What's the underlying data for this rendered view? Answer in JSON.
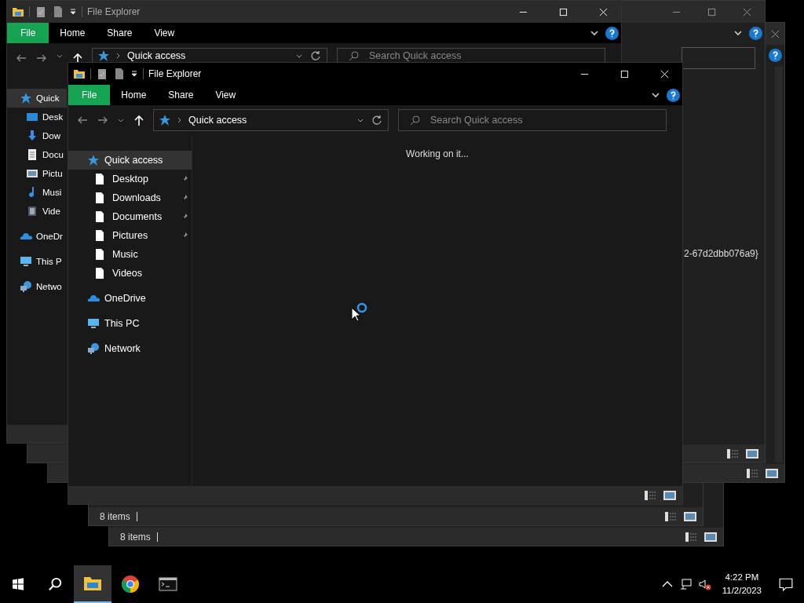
{
  "background_windows": [
    {
      "kind": "status",
      "status_text": "8 items"
    },
    {
      "kind": "status",
      "status_text": "8 items"
    },
    {
      "kind": "edge"
    },
    {
      "kind": "path",
      "path_text": "2-67d2dbb076a9}"
    }
  ],
  "back_window": {
    "title": "File Explorer",
    "tabs": [
      {
        "label": "File",
        "kind": "file"
      },
      {
        "label": "Home",
        "kind": "tab"
      },
      {
        "label": "Share",
        "kind": "tab"
      },
      {
        "label": "View",
        "kind": "tab"
      }
    ],
    "address": "Quick access",
    "search_placeholder": "Search Quick access",
    "nav_items": [
      {
        "label": "Quick",
        "kind": "quick",
        "selected": true,
        "children": [
          {
            "label": "Desk",
            "kind": "desktop"
          },
          {
            "label": "Dow",
            "kind": "downloads"
          },
          {
            "label": "Docu",
            "kind": "documents"
          },
          {
            "label": "Pictu",
            "kind": "pictures"
          },
          {
            "label": "Musi",
            "kind": "music"
          },
          {
            "label": "Vide",
            "kind": "videos"
          }
        ]
      },
      {
        "label": "OneDr",
        "kind": "onedrive",
        "selected": false
      },
      {
        "label": "This P",
        "kind": "pc",
        "selected": false
      },
      {
        "label": "Netwo",
        "kind": "network",
        "selected": false
      }
    ]
  },
  "front_window": {
    "title": "File Explorer",
    "tabs": [
      {
        "label": "File",
        "kind": "file"
      },
      {
        "label": "Home",
        "kind": "tab"
      },
      {
        "label": "Share",
        "kind": "tab"
      },
      {
        "label": "View",
        "kind": "tab"
      }
    ],
    "address": "Quick access",
    "search_placeholder": "Search Quick access",
    "nav_items": [
      {
        "label": "Quick access",
        "kind": "quick",
        "selected": true,
        "children": [
          {
            "label": "Desktop",
            "kind": "file",
            "pinned": true
          },
          {
            "label": "Downloads",
            "kind": "file",
            "pinned": true
          },
          {
            "label": "Documents",
            "kind": "file",
            "pinned": true
          },
          {
            "label": "Pictures",
            "kind": "file",
            "pinned": true
          },
          {
            "label": "Music",
            "kind": "file",
            "pinned": false
          },
          {
            "label": "Videos",
            "kind": "file",
            "pinned": false
          }
        ]
      },
      {
        "label": "OneDrive",
        "kind": "onedrive",
        "selected": false
      },
      {
        "label": "This PC",
        "kind": "pc",
        "selected": false
      },
      {
        "label": "Network",
        "kind": "network",
        "selected": false
      }
    ],
    "message": "Working on it..."
  },
  "taskbar": {
    "apps": [
      {
        "kind": "explorer",
        "selected": true
      },
      {
        "kind": "chrome",
        "selected": false
      },
      {
        "kind": "terminal",
        "selected": false
      }
    ],
    "time": "4:22 PM",
    "date": "11/2/2023"
  }
}
